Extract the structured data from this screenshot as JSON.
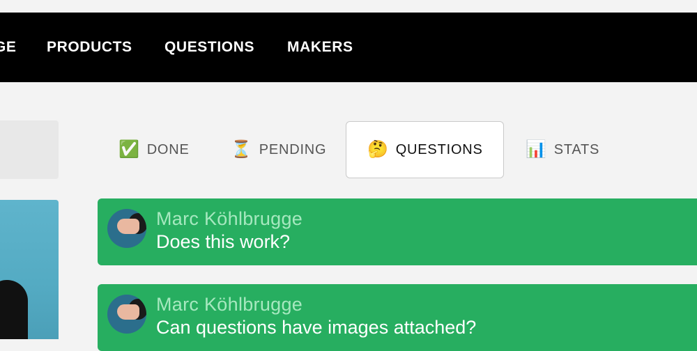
{
  "nav": {
    "items": [
      {
        "label": "GE"
      },
      {
        "label": "PRODUCTS"
      },
      {
        "label": "QUESTIONS"
      },
      {
        "label": "MAKERS"
      }
    ]
  },
  "tabs": [
    {
      "emoji": "✅",
      "label": "DONE",
      "active": false
    },
    {
      "emoji": "⏳",
      "label": "PENDING",
      "active": false
    },
    {
      "emoji": "🤔",
      "label": "QUESTIONS",
      "active": true
    },
    {
      "emoji": "📊",
      "label": "STATS",
      "active": false
    }
  ],
  "questions": [
    {
      "author": "Marc Köhlbrugge",
      "text": "Does this work?"
    },
    {
      "author": "Marc Köhlbrugge",
      "text": "Can questions have images attached?"
    }
  ],
  "colors": {
    "nav_bg": "#000000",
    "page_bg": "#f3f3f3",
    "card_bg": "#27ae60",
    "author_text": "#a6e8bf"
  }
}
